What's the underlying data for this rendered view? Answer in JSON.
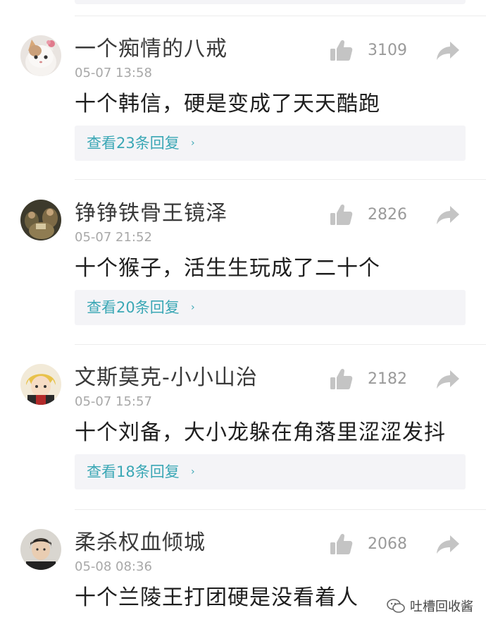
{
  "comments": [
    {
      "username": "一个痴情的八戒",
      "timestamp": "05-07 13:58",
      "likes": "3109",
      "text": "十个韩信，硬是变成了天天酷跑",
      "replies_label": "查看23条回复",
      "avatar": "cat-avatar"
    },
    {
      "username": "铮铮铁骨王镜泽",
      "timestamp": "05-07 21:52",
      "likes": "2826",
      "text": "十个猴子，活生生玩成了二十个",
      "replies_label": "查看20条回复",
      "avatar": "photo-avatar"
    },
    {
      "username": "文斯莫克-小小山治",
      "timestamp": "05-07 15:57",
      "likes": "2182",
      "text": "十个刘备，大小龙躲在角落里涩涩发抖",
      "replies_label": "查看18条回复",
      "avatar": "anime-avatar"
    },
    {
      "username": "柔杀权血倾城",
      "timestamp": "05-08 08:36",
      "likes": "2068",
      "text": "十个兰陵王打团硬是没看着人",
      "avatar": "portrait-avatar"
    }
  ],
  "reply_chevron": "›",
  "watermark": {
    "label": "吐槽回收酱",
    "icon": "wechat-icon"
  },
  "colors": {
    "accent": "#3aa7b5",
    "icon_gray": "#c4c4c4",
    "text": "#1e1e1e",
    "meta": "#a8a8a8"
  }
}
